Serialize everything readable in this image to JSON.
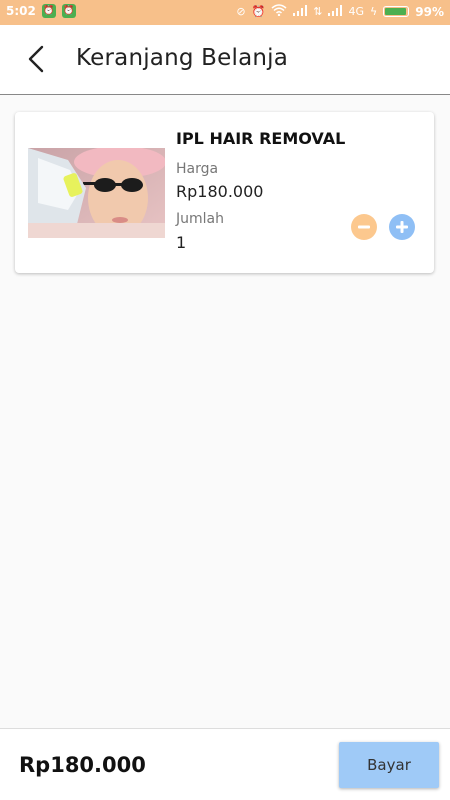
{
  "status_bar": {
    "time": "5:02",
    "network": "4G",
    "battery_percent": "99%",
    "battery_level": 0.99,
    "icons": [
      "alarm-app-icon",
      "alarm-app-icon",
      "sync-off-icon",
      "alarm-clock-icon",
      "wifi-icon",
      "signal-icon",
      "data-arrows-icon",
      "signal-icon",
      "charging-icon"
    ]
  },
  "header": {
    "back_icon": "back-arrow-icon",
    "title": "Keranjang Belanja"
  },
  "cart": {
    "items": [
      {
        "name": "IPL HAIR REMOVAL",
        "price_label": "Harga",
        "price": "Rp180.000",
        "qty_label": "Jumlah",
        "qty": "1",
        "image": "product-photo"
      }
    ]
  },
  "footer": {
    "total": "Rp180.000",
    "pay_label": "Bayar"
  },
  "colors": {
    "status_bar": "#f7c08a",
    "minus_button": "#fcc88e",
    "plus_button": "#8fbff5",
    "pay_button": "#9fcaf7"
  }
}
